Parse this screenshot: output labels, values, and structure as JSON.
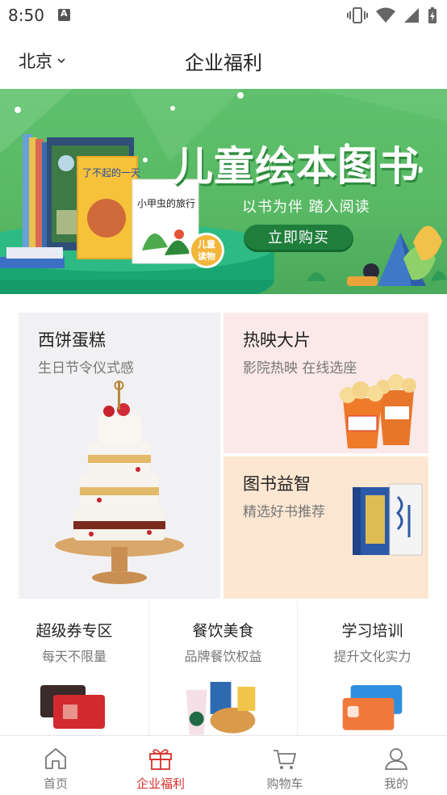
{
  "status_bar": {
    "time": "8:50"
  },
  "header": {
    "city": "北京",
    "title": "企业福利"
  },
  "banner": {
    "title": "儿童绘本图书",
    "subtitle": "以书为伴 踏入阅读",
    "button": "立即购买",
    "book_titles": [
      "了不起的一天",
      "小甲虫的旅行"
    ],
    "badge": [
      "儿童",
      "读物"
    ]
  },
  "categories": [
    {
      "title": "西饼蛋糕",
      "subtitle": "生日节令仪式感"
    },
    {
      "title": "热映大片",
      "subtitle": "影院热映 在线选座"
    },
    {
      "title": "图书益智",
      "subtitle": "精选好书推荐"
    }
  ],
  "mini_cards": [
    {
      "title": "超级券专区",
      "subtitle": "每天不限量"
    },
    {
      "title": "餐饮美食",
      "subtitle": "品牌餐饮权益"
    },
    {
      "title": "学习培训",
      "subtitle": "提升文化实力"
    }
  ],
  "tabbar": {
    "items": [
      {
        "label": "首页",
        "icon": "home-icon"
      },
      {
        "label": "企业福利",
        "icon": "gift-icon",
        "active": true
      },
      {
        "label": "购物车",
        "icon": "cart-icon"
      },
      {
        "label": "我的",
        "icon": "user-icon"
      }
    ]
  },
  "colors": {
    "accent": "#d7302a",
    "banner_green": "#5fc16d",
    "button_green": "#1f7e3c"
  }
}
